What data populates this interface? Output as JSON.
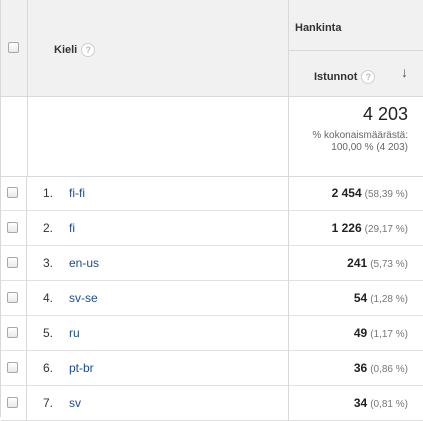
{
  "header": {
    "dimension_label": "Kieli",
    "dimension_help": "?",
    "group_label": "Hankinta",
    "metric_label": "Istunnot",
    "metric_help": "?",
    "sort_arrow": "↓"
  },
  "summary": {
    "total": "4 203",
    "pct_label": "% kokonaismäärästä:",
    "pct_value": "100,00 % (4 203)"
  },
  "rows": [
    {
      "index": "1.",
      "language": "fi-fi",
      "sessions": "2 454",
      "percent": "(58,39 %)"
    },
    {
      "index": "2.",
      "language": "fi",
      "sessions": "1 226",
      "percent": "(29,17 %)"
    },
    {
      "index": "3.",
      "language": "en-us",
      "sessions": "241",
      "percent": "(5,73 %)"
    },
    {
      "index": "4.",
      "language": "sv-se",
      "sessions": "54",
      "percent": "(1,28 %)"
    },
    {
      "index": "5.",
      "language": "ru",
      "sessions": "49",
      "percent": "(1,17 %)"
    },
    {
      "index": "6.",
      "language": "pt-br",
      "sessions": "36",
      "percent": "(0,86 %)"
    },
    {
      "index": "7.",
      "language": "sv",
      "sessions": "34",
      "percent": "(0,81 %)"
    }
  ]
}
